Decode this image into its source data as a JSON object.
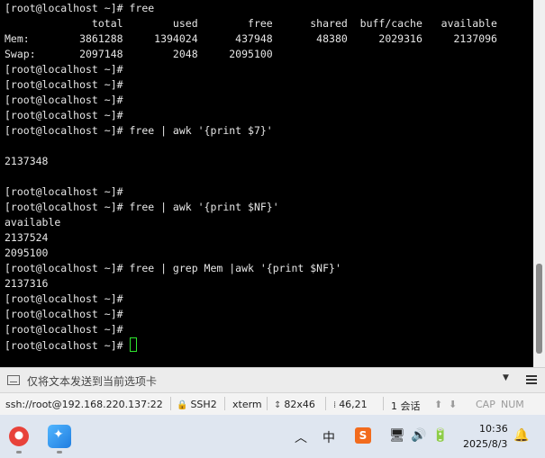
{
  "terminal": {
    "lines": [
      "[root@localhost ~]# free",
      "              total        used        free      shared  buff/cache   available",
      "Mem:        3861288     1394024      437948       48380     2029316     2137096",
      "Swap:       2097148        2048     2095100",
      "[root@localhost ~]#",
      "[root@localhost ~]#",
      "[root@localhost ~]#",
      "[root@localhost ~]#",
      "[root@localhost ~]# free | awk '{print $7}'",
      "",
      "2137348",
      "",
      "[root@localhost ~]#",
      "[root@localhost ~]# free | awk '{print $NF}'",
      "available",
      "2137524",
      "2095100",
      "[root@localhost ~]# free | grep Mem |awk '{print $NF}'",
      "2137316",
      "[root@localhost ~]#",
      "[root@localhost ~]#",
      "[root@localhost ~]#"
    ],
    "prompt": "[root@localhost ~]# "
  },
  "sendbar": {
    "placeholder": "仅将文本发送到当前选项卡",
    "dropdown_icon": "chevron-down-icon",
    "menu_icon": "hamburger-menu-icon"
  },
  "statusbar": {
    "connection": "ssh://root@192.168.220.137:22",
    "protocol": "SSH2",
    "terminal_type": "xterm",
    "size": "82x46",
    "cursor_pos": "46,21",
    "sessions": "1 会话",
    "cap": "CAP",
    "num": "NUM"
  },
  "taskbar": {
    "time": "10:36",
    "date": "2025/8/3",
    "ime_label": "中",
    "sogou_label": "S"
  },
  "colors": {
    "terminal_bg": "#000000",
    "terminal_fg": "#e6e6e6",
    "cursor": "#2ee62e",
    "taskbar_bg": "#dfe6f0"
  }
}
